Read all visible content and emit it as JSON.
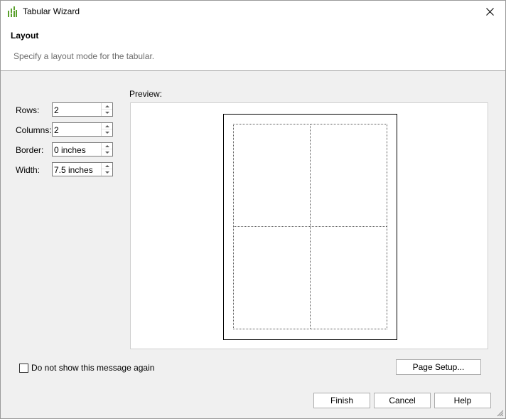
{
  "window": {
    "title": "Tabular Wizard"
  },
  "header": {
    "title": "Layout",
    "subtitle": "Specify a layout mode for the tabular."
  },
  "fields": {
    "rows": {
      "label": "Rows:",
      "value": "2"
    },
    "columns": {
      "label": "Columns:",
      "value": "2"
    },
    "border": {
      "label": "Border:",
      "value": "0 inches"
    },
    "width": {
      "label": "Width:",
      "value": "7.5 inches"
    }
  },
  "preview": {
    "label": "Preview:"
  },
  "options": {
    "dont_show_label": "Do not show this message again",
    "dont_show_checked": false
  },
  "buttons": {
    "page_setup": "Page Setup...",
    "finish": "Finish",
    "cancel": "Cancel",
    "help": "Help"
  },
  "colors": {
    "app_icon_green": "#5aa02c",
    "header_bg": "#ffffff",
    "dialog_bg": "#f0f0f0"
  }
}
